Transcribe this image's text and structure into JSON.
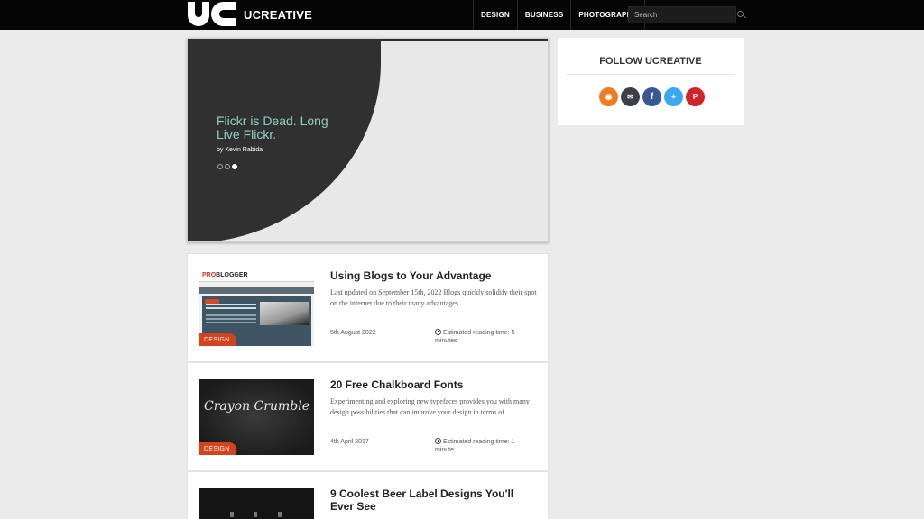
{
  "header": {
    "brand": "UCREATIVE",
    "nav": [
      "DESIGN",
      "BUSINESS",
      "PHOTOGRAPHY"
    ],
    "search_placeholder": "Search"
  },
  "slider": {
    "title": "Flickr is Dead. Long Live Flickr.",
    "byline": "by Kevin Rabida",
    "dots": 3,
    "active_dot": 3
  },
  "sidebar": {
    "follow_title": "FOLLOW UCREATIVE",
    "socials": [
      {
        "name": "rss-icon",
        "glyph": "◉",
        "color": "#ef7b22"
      },
      {
        "name": "email-icon",
        "glyph": "✉",
        "color": "#3a3f48"
      },
      {
        "name": "facebook-icon",
        "glyph": "f",
        "color": "#395794"
      },
      {
        "name": "twitter-icon",
        "glyph": "✦",
        "color": "#3aaaf0"
      },
      {
        "name": "pinterest-icon",
        "glyph": "P",
        "color": "#d0242a"
      }
    ]
  },
  "posts": [
    {
      "title": "Using Blogs to Your Advantage",
      "excerpt": "Last updated on September 15th, 2022 Blogs quickly solidify their spot on the internet due to their many advantages. ...",
      "category": "DESIGN",
      "date": "5th August 2022",
      "reading": "Estimated reading time: 5 minutes",
      "thumb_logo_a": "PRO",
      "thumb_logo_b": "BLOGGER"
    },
    {
      "title": "20 Free Chalkboard Fonts",
      "excerpt": "Experimenting and exploring new typefaces provides you with many design possibilities that can improve your design in terms of ...",
      "category": "DESIGN",
      "date": "4th April 2017",
      "reading": "Estimated reading time: 1 minute",
      "thumb_text": "Crayon Crumble"
    },
    {
      "title": "9 Coolest Beer Label Designs You'll Ever See"
    }
  ],
  "colors": {
    "accent": "#d2431e",
    "slider_title": "#8fd0c4",
    "header_bg": "#050505",
    "page_bg": "#ebebeb"
  }
}
